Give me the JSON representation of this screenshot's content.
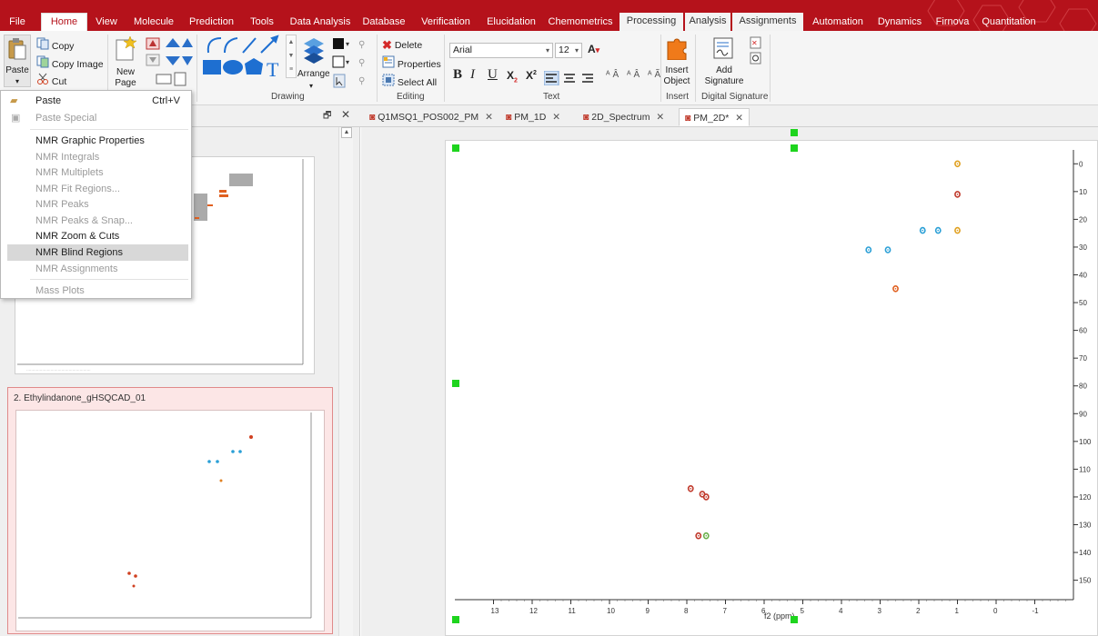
{
  "menu_tabs": [
    "File",
    "Home",
    "View",
    "Molecule",
    "Prediction",
    "Tools",
    "Data Analysis",
    "Database",
    "Verification",
    "Elucidation",
    "Chemometrics",
    "Processing",
    "Analysis",
    "Assignments",
    "Automation",
    "Dynamics",
    "Firnova",
    "Quantitation"
  ],
  "ribbon": {
    "paste": "Paste",
    "copy": "Copy",
    "copy_image": "Copy Image",
    "cut": "Cut",
    "new_page_1": "New",
    "new_page_2": "Page",
    "arrange": "Arrange",
    "drawing": "Drawing",
    "delete": "Delete",
    "properties": "Properties",
    "select_all": "Select All",
    "editing": "Editing",
    "font_name": "Arial",
    "font_size": "12",
    "text": "Text",
    "insert_object_1": "Insert",
    "insert_object_2": "Object",
    "insert": "Insert",
    "add_signature_1": "Add",
    "add_signature_2": "Signature",
    "digital_signature": "Digital Signature"
  },
  "doc_tabs": [
    "Q1MSQ1_POS002_PM",
    "PM_1D",
    "2D_Spectrum",
    "PM_2D*"
  ],
  "paste_menu": [
    {
      "label": "Paste",
      "shortcut": "Ctrl+V",
      "state": "enabled"
    },
    {
      "label": "Paste Special",
      "shortcut": "",
      "state": "disabled"
    },
    {
      "label": "NMR Graphic Properties",
      "shortcut": "",
      "state": "enabled"
    },
    {
      "label": "NMR Integrals",
      "shortcut": "",
      "state": "disabled"
    },
    {
      "label": "NMR Multiplets",
      "shortcut": "",
      "state": "disabled"
    },
    {
      "label": "NMR Fit Regions...",
      "shortcut": "",
      "state": "disabled"
    },
    {
      "label": "NMR Peaks",
      "shortcut": "",
      "state": "disabled"
    },
    {
      "label": "NMR Peaks & Snap...",
      "shortcut": "",
      "state": "disabled"
    },
    {
      "label": "NMR Zoom & Cuts",
      "shortcut": "",
      "state": "enabled"
    },
    {
      "label": "NMR Blind Regions",
      "shortcut": "",
      "state": "highlighted"
    },
    {
      "label": "NMR Assignments",
      "shortcut": "",
      "state": "disabled"
    },
    {
      "label": "Mass Plots",
      "shortcut": "",
      "state": "disabled"
    }
  ],
  "left_panel": {
    "card2_title": "2. Ethylindanone_gHSQCAD_01"
  },
  "spectrum": {
    "x_axis_label": "f2 (ppm)",
    "x_ticks": [
      "13",
      "12",
      "11",
      "10",
      "9",
      "8",
      "7",
      "6",
      "5",
      "4",
      "3",
      "2",
      "1",
      "0",
      "-1"
    ],
    "y_ticks": [
      "0",
      "10",
      "20",
      "30",
      "40",
      "50",
      "60",
      "70",
      "80",
      "90",
      "100",
      "110",
      "120",
      "130",
      "140",
      "150"
    ]
  },
  "chart_data": {
    "type": "scatter",
    "title": "",
    "xlabel": "f2 (ppm)",
    "xlim": [
      14,
      -2
    ],
    "ylim": [
      -5,
      157
    ],
    "peaks": [
      {
        "x": 1.0,
        "y": 11,
        "color": "#c0392b"
      },
      {
        "x": 1.0,
        "y": 0,
        "color": "#e0a020"
      },
      {
        "x": 1.0,
        "y": 24,
        "color": "#e0a020"
      },
      {
        "x": 1.9,
        "y": 24,
        "color": "#2a9fd6"
      },
      {
        "x": 1.5,
        "y": 24,
        "color": "#2a9fd6"
      },
      {
        "x": 3.3,
        "y": 31,
        "color": "#2a9fd6"
      },
      {
        "x": 2.8,
        "y": 31,
        "color": "#2a9fd6"
      },
      {
        "x": 2.6,
        "y": 45,
        "color": "#e06020"
      },
      {
        "x": 7.9,
        "y": 117,
        "color": "#c0392b"
      },
      {
        "x": 7.6,
        "y": 119,
        "color": "#c0392b"
      },
      {
        "x": 7.5,
        "y": 120,
        "color": "#c0392b"
      },
      {
        "x": 7.7,
        "y": 134,
        "color": "#c0392b"
      },
      {
        "x": 7.5,
        "y": 134,
        "color": "#6ab04c"
      }
    ]
  },
  "colors": {
    "brand": "#b5121b",
    "highlight": "#d8d8d8",
    "peak_blue": "#2a9fd6",
    "peak_red": "#c0392b"
  }
}
